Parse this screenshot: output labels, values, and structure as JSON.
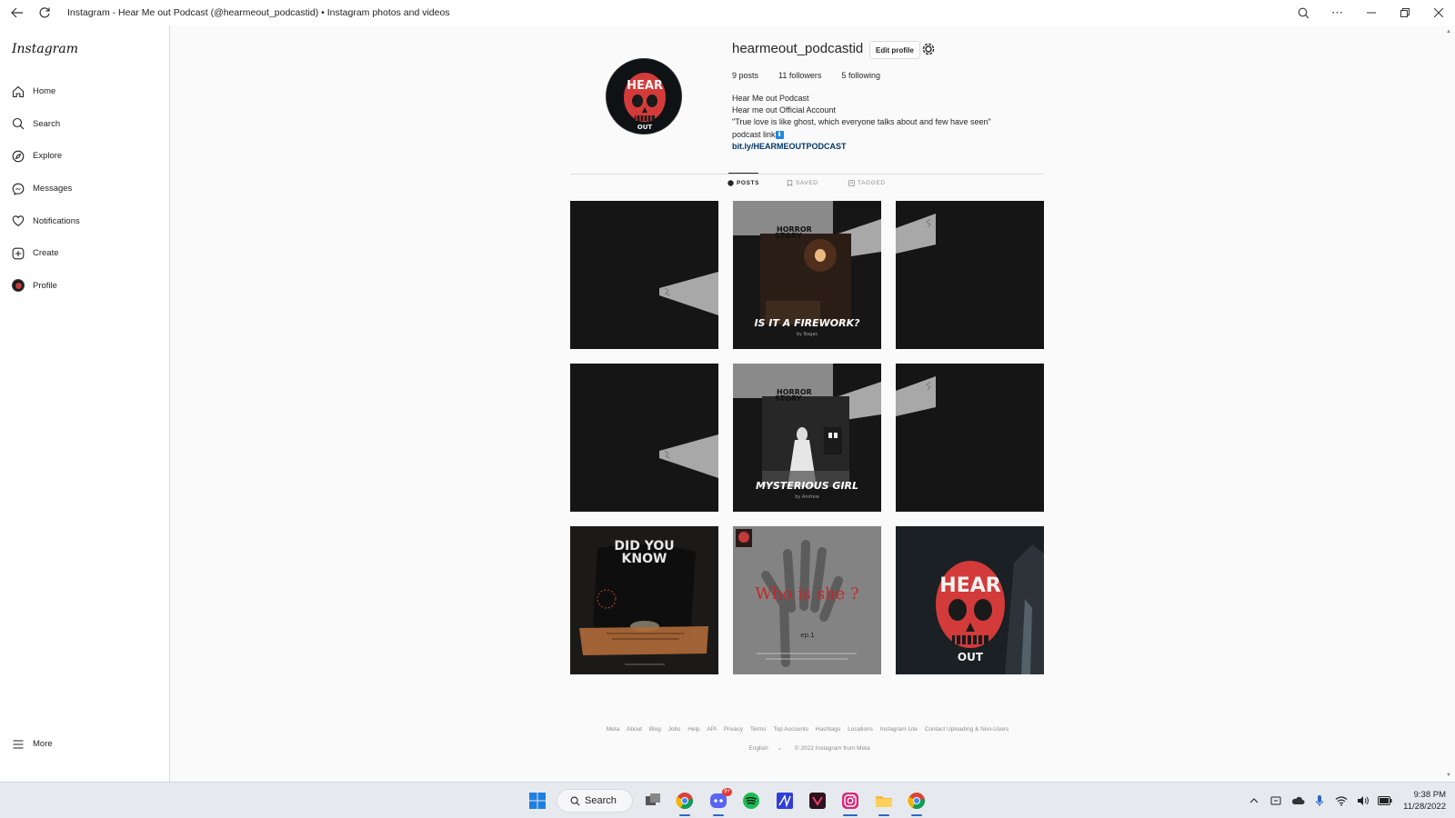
{
  "window": {
    "title": "Instagram - Hear Me out Podcast (@hearmeout_podcastid) • Instagram photos and videos"
  },
  "sidebar": {
    "logo": "Instagram",
    "items": [
      {
        "label": "Home",
        "icon": "home-icon"
      },
      {
        "label": "Search",
        "icon": "search-icon"
      },
      {
        "label": "Explore",
        "icon": "compass-icon"
      },
      {
        "label": "Messages",
        "icon": "messenger-icon"
      },
      {
        "label": "Notifications",
        "icon": "heart-icon"
      },
      {
        "label": "Create",
        "icon": "plus-square-icon"
      },
      {
        "label": "Profile",
        "icon": "avatar-icon"
      }
    ],
    "more_label": "More"
  },
  "profile": {
    "username": "hearmeout_podcastid",
    "edit_label": "Edit profile",
    "stats": {
      "posts_count": "9",
      "posts_label": "posts",
      "followers_count": "11",
      "followers_label": "followers",
      "following_count": "5",
      "following_label": "following"
    },
    "bio": {
      "name": "Hear Me out Podcast",
      "line1": "Hear me out Official Account",
      "line2": "\"True love is like ghost, which everyone talks about and few have seen\"",
      "line3": "podcast link",
      "link_emoji": "⬇",
      "link": "bit.ly/HEARMEOUTPODCAST"
    }
  },
  "tabs": [
    {
      "label": "POSTS",
      "active": true
    },
    {
      "label": "SAVED",
      "active": false
    },
    {
      "label": "TAGGED",
      "active": false
    }
  ],
  "posts": [
    {
      "kind": "tape-right",
      "title": "",
      "byline": ""
    },
    {
      "kind": "horror",
      "tag": "HORROR\nSTORY",
      "title": "IS IT A FIREWORK?",
      "byline": "by Bagas"
    },
    {
      "kind": "tape-left",
      "title": "",
      "byline": ""
    },
    {
      "kind": "tape-right",
      "title": "",
      "byline": ""
    },
    {
      "kind": "horror",
      "tag": "HORROR\nSTORY",
      "title": "MYSTERIOUS GIRL",
      "byline": "by Andrew"
    },
    {
      "kind": "tape-left",
      "title": "",
      "byline": ""
    },
    {
      "kind": "didyouknow",
      "title": "DID YOU\nKNOW",
      "byline": ""
    },
    {
      "kind": "whoisshe",
      "title": "Who is she ?",
      "byline": "ep.1"
    },
    {
      "kind": "logo",
      "title": "",
      "byline": ""
    }
  ],
  "post_texts": {
    "p2_tag1": "HORROR",
    "p2_tag2": "STORY",
    "p2_title": "IS IT A FIREWORK?",
    "p2_by": "by Bagas",
    "p5_tag1": "HORROR",
    "p5_tag2": "STORY",
    "p5_title": "MYSTERIOUS GIRL",
    "p5_by": "by Andrew",
    "p7_title1": "DID YOU",
    "p7_title2": "KNOW",
    "p8_title": "Who is she ?",
    "p8_ep": "ep.1"
  },
  "footer": {
    "links": [
      "Meta",
      "About",
      "Blog",
      "Jobs",
      "Help",
      "API",
      "Privacy",
      "Terms",
      "Top Accounts",
      "Hashtags",
      "Locations",
      "Instagram Lite",
      "Contact Uploading & Non-Users"
    ],
    "language": "English",
    "language_chevron": "⌄",
    "copyright": "© 2022 Instagram from Meta"
  },
  "taskbar": {
    "search_label": "Search",
    "discord_badge": "9+",
    "time": "9:38 PM",
    "date": "11/28/2022"
  },
  "colors": {
    "accent_red": "#c62828",
    "link_blue": "#00376b",
    "taskbar_bg": "#e6eaef"
  }
}
